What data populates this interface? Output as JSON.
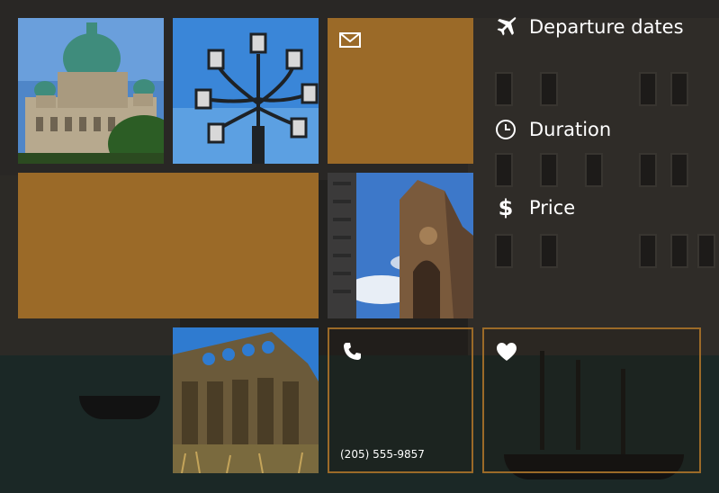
{
  "tiles": {
    "phone": {
      "number": "(205) 555-9857",
      "icon": "phone-icon"
    },
    "mail": {
      "icon": "mail-icon"
    },
    "favorite": {
      "icon": "heart-icon"
    }
  },
  "menu": [
    {
      "label": "Departure dates",
      "icon": "airplane-icon"
    },
    {
      "label": "Duration",
      "icon": "clock-icon"
    },
    {
      "label": "Price",
      "icon": "dollar-icon"
    }
  ],
  "colors": {
    "accent": "#9b6a28",
    "text": "#ffffff"
  }
}
